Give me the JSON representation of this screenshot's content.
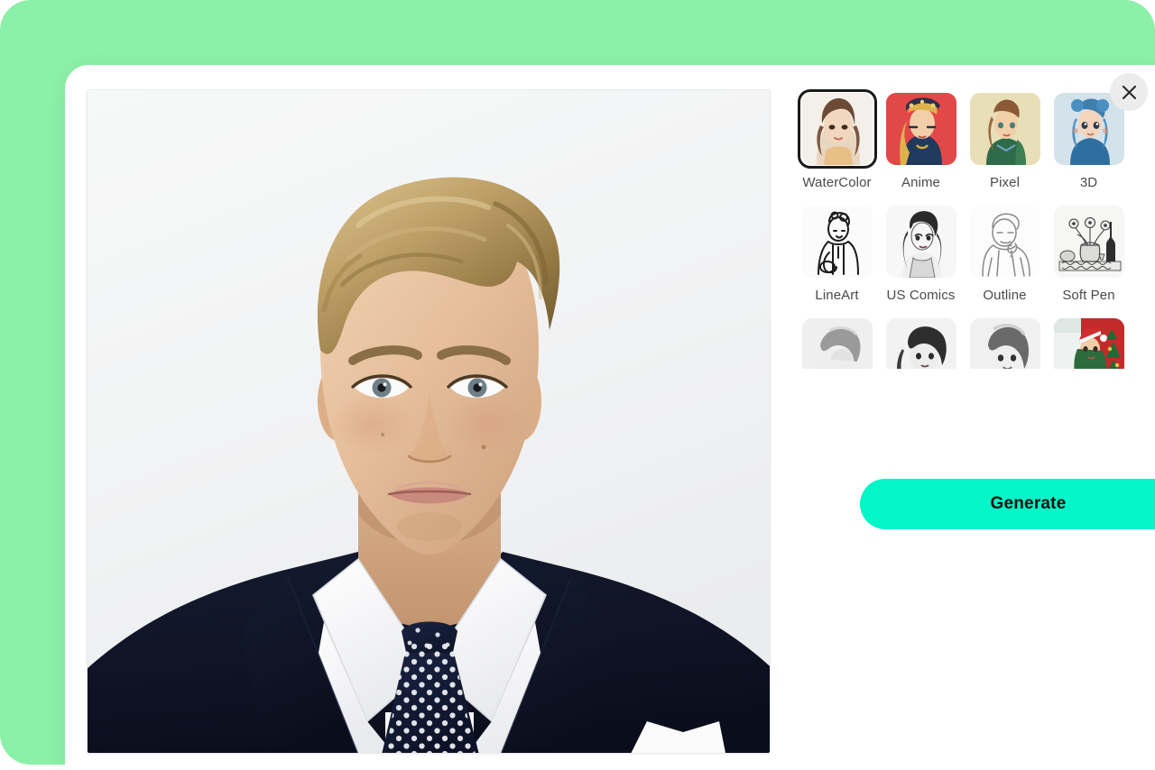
{
  "theme": {
    "backdrop_color": "#8bf0a8",
    "modal_color": "#ffffff",
    "accent_color": "#04f5c8",
    "selected_border_color": "#1a1a1a",
    "label_color": "#4a4a4a"
  },
  "modal": {
    "close_label": "Close",
    "close_icon": "close-icon"
  },
  "preview": {
    "alt": "Portrait photo of a blond man in a dark navy suit, white shirt and navy polka-dot tie on a light background",
    "background_color": "#f3f4f5",
    "suit_color": "#10162a",
    "shirt_color": "#ffffff",
    "tie_color": "#11182f",
    "hair_color": "#b79a62",
    "skin_color": "#e8c3a3"
  },
  "styles": {
    "selected": "WaterColor",
    "items": [
      {
        "label": "WaterColor",
        "selected": true,
        "thumb_bg": "#f3efe9",
        "thumb_icon": "watercolor-portrait-thumb"
      },
      {
        "label": "Anime",
        "selected": false,
        "thumb_bg": "#e24848",
        "thumb_icon": "anime-portrait-thumb"
      },
      {
        "label": "Pixel",
        "selected": false,
        "thumb_bg": "#e8dfb8",
        "thumb_icon": "pixel-portrait-thumb"
      },
      {
        "label": "3D",
        "selected": false,
        "thumb_bg": "#d4e2ea",
        "thumb_icon": "3d-portrait-thumb"
      },
      {
        "label": "LineArt",
        "selected": false,
        "thumb_bg": "#fbfbfc",
        "thumb_icon": "lineart-portrait-thumb"
      },
      {
        "label": "US Comics",
        "selected": false,
        "thumb_bg": "#f7f7f8",
        "thumb_icon": "us-comics-portrait-thumb"
      },
      {
        "label": "Outline",
        "selected": false,
        "thumb_bg": "#fcfcfc",
        "thumb_icon": "outline-portrait-thumb"
      },
      {
        "label": "Soft Pen",
        "selected": false,
        "thumb_bg": "#f6f6f4",
        "thumb_icon": "soft-pen-stilllife-thumb"
      },
      {
        "label": "",
        "selected": false,
        "thumb_bg": "#efefef",
        "thumb_icon": "sketch-portrait-thumb-a"
      },
      {
        "label": "",
        "selected": false,
        "thumb_bg": "#f2f2f2",
        "thumb_icon": "sketch-portrait-thumb-b"
      },
      {
        "label": "",
        "selected": false,
        "thumb_bg": "#f0f0f0",
        "thumb_icon": "sketch-portrait-thumb-c"
      },
      {
        "label": "",
        "selected": false,
        "thumb_bg": "#c32b2b",
        "thumb_icon": "christmas-portrait-thumb"
      }
    ]
  },
  "actions": {
    "generate_label": "Generate"
  }
}
